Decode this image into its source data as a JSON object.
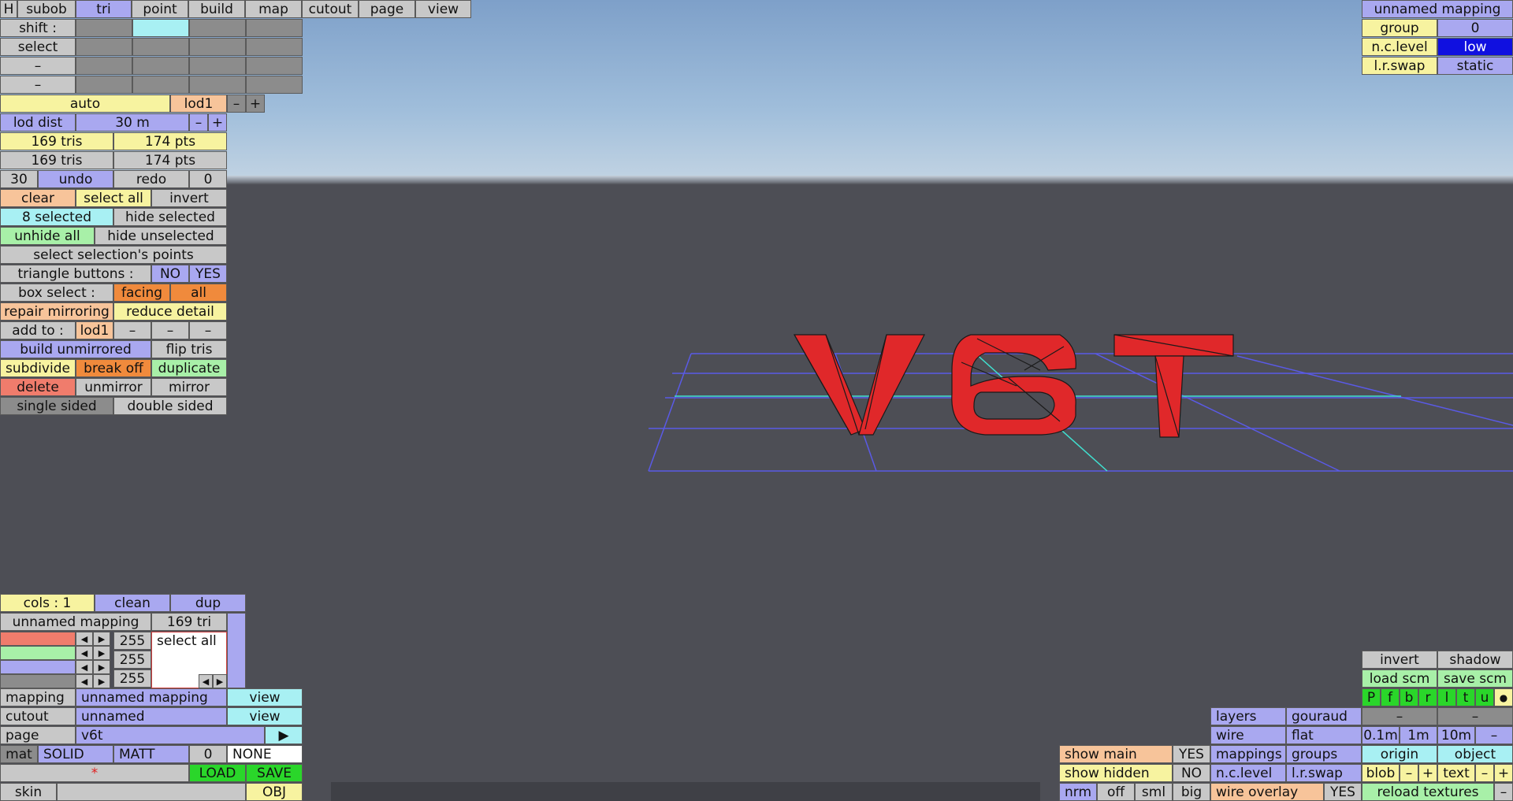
{
  "top_menu": {
    "h": "H",
    "subob": "subob",
    "tri": "tri",
    "point": "point",
    "build": "build",
    "map": "map",
    "cutout": "cutout",
    "page": "page",
    "view": "view"
  },
  "left_panel": {
    "shift": "shift :",
    "select": "select",
    "dash": "–",
    "auto": "auto",
    "lod1": "lod1",
    "minus": "–",
    "plus": "+",
    "lod_dist": "lod dist",
    "lod_dist_value": "30 m",
    "tris1": "169 tris",
    "pts1": "174 pts",
    "tris2": "169 tris",
    "pts2": "174 pts",
    "undo_count": "30",
    "undo": "undo",
    "redo": "redo",
    "redo_count": "0",
    "clear": "clear",
    "select_all": "select all",
    "invert": "invert",
    "selected": "8 selected",
    "hide_selected": "hide selected",
    "unhide_all": "unhide all",
    "hide_unselected": "hide unselected",
    "select_points": "select selection's points",
    "triangle_buttons": "triangle buttons :",
    "no": "NO",
    "yes": "YES",
    "box_select": "box select :",
    "facing": "facing",
    "all": "all",
    "repair_mirroring": "repair mirroring",
    "reduce_detail": "reduce detail",
    "add_to": "add to :",
    "add_lod1": "lod1",
    "build_unmirrored": "build unmirrored",
    "flip_tris": "flip tris",
    "subdivide": "subdivide",
    "break_off": "break off",
    "duplicate": "duplicate",
    "delete": "delete",
    "unmirror": "unmirror",
    "mirror": "mirror",
    "single_sided": "single sided",
    "double_sided": "double sided"
  },
  "top_right": {
    "mapping_name": "unnamed mapping",
    "group": "group",
    "group_value": "0",
    "nc_level": "n.c.level",
    "nc_value": "low",
    "lr_swap": "l.r.swap",
    "lr_value": "static"
  },
  "bottom_left": {
    "cols": "cols : 1",
    "clean": "clean",
    "dup": "dup",
    "mapping_name": "unnamed mapping",
    "tri_count": "169 tri",
    "r": "255",
    "g": "255",
    "b": "255",
    "select_all": "select all",
    "left_arrow": "◀",
    "right_arrow": "▶",
    "mapping": "mapping",
    "mapping_value": "unnamed mapping",
    "view": "view",
    "cutout": "cutout",
    "cutout_value": "unnamed",
    "page": "page",
    "page_value": "v6t",
    "mat": "mat",
    "solid": "SOLID",
    "matt": "MATT",
    "mat_num": "0",
    "none": "NONE",
    "asterisk": "*",
    "load": "LOAD",
    "save": "SAVE",
    "skin": "skin",
    "obj": "OBJ"
  },
  "bottom_right": {
    "invert": "invert",
    "shadow": "shadow",
    "load_scm": "load scm",
    "save_scm": "save scm",
    "view_letters": [
      "P",
      "f",
      "b",
      "r",
      "l",
      "t",
      "u"
    ],
    "dot": "●",
    "layers": "layers",
    "gouraud": "gouraud",
    "dash": "–",
    "wire": "wire",
    "flat": "flat",
    "d01": "0.1m",
    "d1": "1m",
    "d10": "10m",
    "show_main": "show main",
    "show_main_val": "YES",
    "mappings": "mappings",
    "groups": "groups",
    "origin": "origin",
    "object": "object",
    "show_hidden": "show hidden",
    "show_hidden_val": "NO",
    "nc_level": "n.c.level",
    "lr_swap": "l.r.swap",
    "blob": "blob",
    "minus": "–",
    "plus": "+",
    "text": "text",
    "nrm": "nrm",
    "off": "off",
    "sml": "sml",
    "big": "big",
    "wire_overlay": "wire overlay",
    "wire_overlay_val": "YES",
    "reload_textures": "reload textures"
  },
  "colors": {
    "model_fill": "#e0282a",
    "grid_line": "#5a5ae6",
    "axis_line": "#40e0d0"
  }
}
